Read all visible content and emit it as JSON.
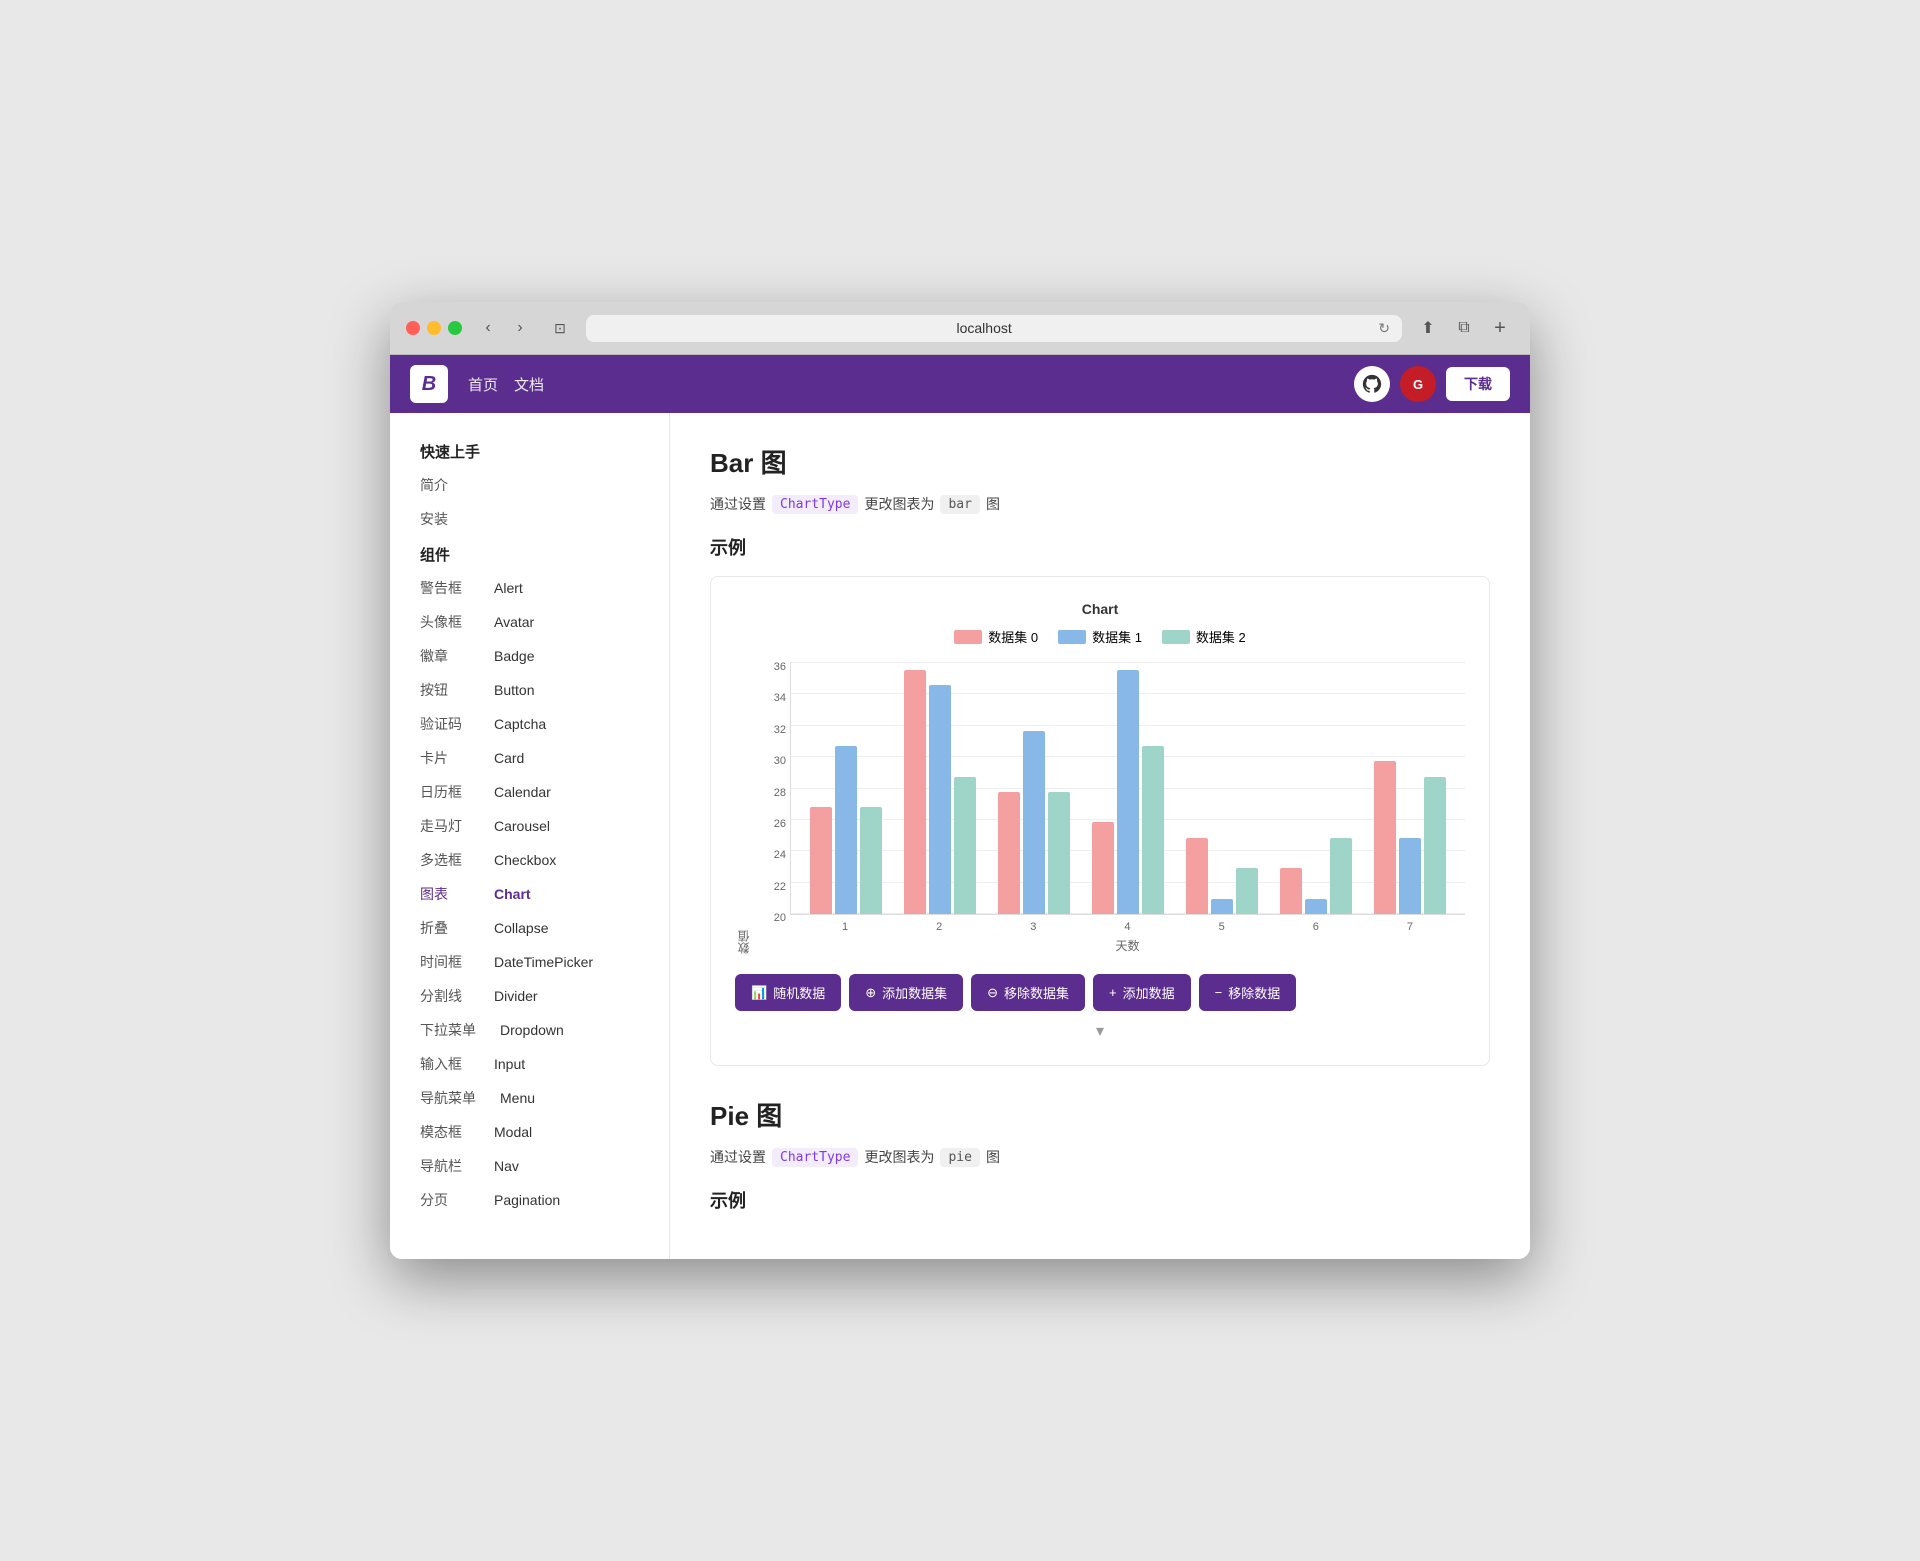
{
  "browser": {
    "url": "localhost",
    "back_label": "‹",
    "forward_label": "›",
    "tab_label": "⊡",
    "reload_label": "↻",
    "share_label": "⬆",
    "duplicate_label": "⧉",
    "plus_label": "+"
  },
  "header": {
    "logo": "B",
    "nav": [
      "首页",
      "文档"
    ],
    "github_label": "G",
    "gitee_label": "G",
    "download_label": "下载"
  },
  "sidebar": {
    "sections": [
      {
        "title": "快速上手",
        "items": [
          {
            "cn": "简介",
            "en": ""
          },
          {
            "cn": "安装",
            "en": ""
          }
        ]
      },
      {
        "title": "组件",
        "items": [
          {
            "cn": "警告框",
            "en": "Alert"
          },
          {
            "cn": "头像框",
            "en": "Avatar"
          },
          {
            "cn": "徽章",
            "en": "Badge"
          },
          {
            "cn": "按钮",
            "en": "Button"
          },
          {
            "cn": "验证码",
            "en": "Captcha"
          },
          {
            "cn": "卡片",
            "en": "Card"
          },
          {
            "cn": "日历框",
            "en": "Calendar"
          },
          {
            "cn": "走马灯",
            "en": "Carousel"
          },
          {
            "cn": "多选框",
            "en": "Checkbox"
          },
          {
            "cn": "图表",
            "en": "Chart",
            "active": true
          },
          {
            "cn": "折叠",
            "en": "Collapse"
          },
          {
            "cn": "时间框",
            "en": "DateTimePicker"
          },
          {
            "cn": "分割线",
            "en": "Divider"
          },
          {
            "cn": "下拉菜单",
            "en": "Dropdown"
          },
          {
            "cn": "输入框",
            "en": "Input"
          },
          {
            "cn": "导航菜单",
            "en": "Menu"
          },
          {
            "cn": "模态框",
            "en": "Modal"
          },
          {
            "cn": "导航栏",
            "en": "Nav"
          },
          {
            "cn": "分页",
            "en": "Pagination"
          }
        ]
      }
    ]
  },
  "bar_section": {
    "title": "Bar 图",
    "desc_prefix": "通过设置",
    "desc_code1": "ChartType",
    "desc_middle": "更改图表为",
    "desc_code2": "bar",
    "desc_suffix": "图",
    "example_title": "示例",
    "chart_title": "Chart",
    "legend": [
      {
        "label": "数据集 0",
        "color": "#f4a0a0"
      },
      {
        "label": "数据集 1",
        "color": "#87b8e8"
      },
      {
        "label": "数据集 2",
        "color": "#9fd4c8"
      }
    ],
    "y_axis_title": "数值",
    "x_axis_title": "天数",
    "y_labels": [
      "20",
      "22",
      "24",
      "26",
      "28",
      "30",
      "32",
      "34",
      "36"
    ],
    "x_labels": [
      "1",
      "2",
      "3",
      "4",
      "5",
      "6",
      "7"
    ],
    "data": [
      {
        "x": "1",
        "d0": 27,
        "d1": 31,
        "d2": 27
      },
      {
        "x": "2",
        "d0": 36,
        "d1": 35,
        "d2": 29
      },
      {
        "x": "3",
        "d0": 28,
        "d1": 32,
        "d2": 28
      },
      {
        "x": "4",
        "d0": 26,
        "d1": 36,
        "d2": 31
      },
      {
        "x": "5",
        "d0": 25,
        "d1": 21,
        "d2": 23
      },
      {
        "x": "6",
        "d0": 23,
        "d1": 21,
        "d2": 25
      },
      {
        "x": "7",
        "d0": 30,
        "d1": 25,
        "d2": 29
      }
    ],
    "y_min": 20,
    "y_max": 36,
    "buttons": [
      {
        "label": "随机数据",
        "icon": "📊"
      },
      {
        "label": "添加数据集",
        "icon": "+"
      },
      {
        "label": "移除数据集",
        "icon": "−"
      },
      {
        "label": "添加数据",
        "icon": "+"
      },
      {
        "label": "移除数据",
        "icon": "−"
      }
    ]
  },
  "pie_section": {
    "title": "Pie 图",
    "desc_prefix": "通过设置",
    "desc_code1": "ChartType",
    "desc_middle": "更改图表为",
    "desc_code2": "pie",
    "desc_suffix": "图",
    "example_title": "示例"
  }
}
